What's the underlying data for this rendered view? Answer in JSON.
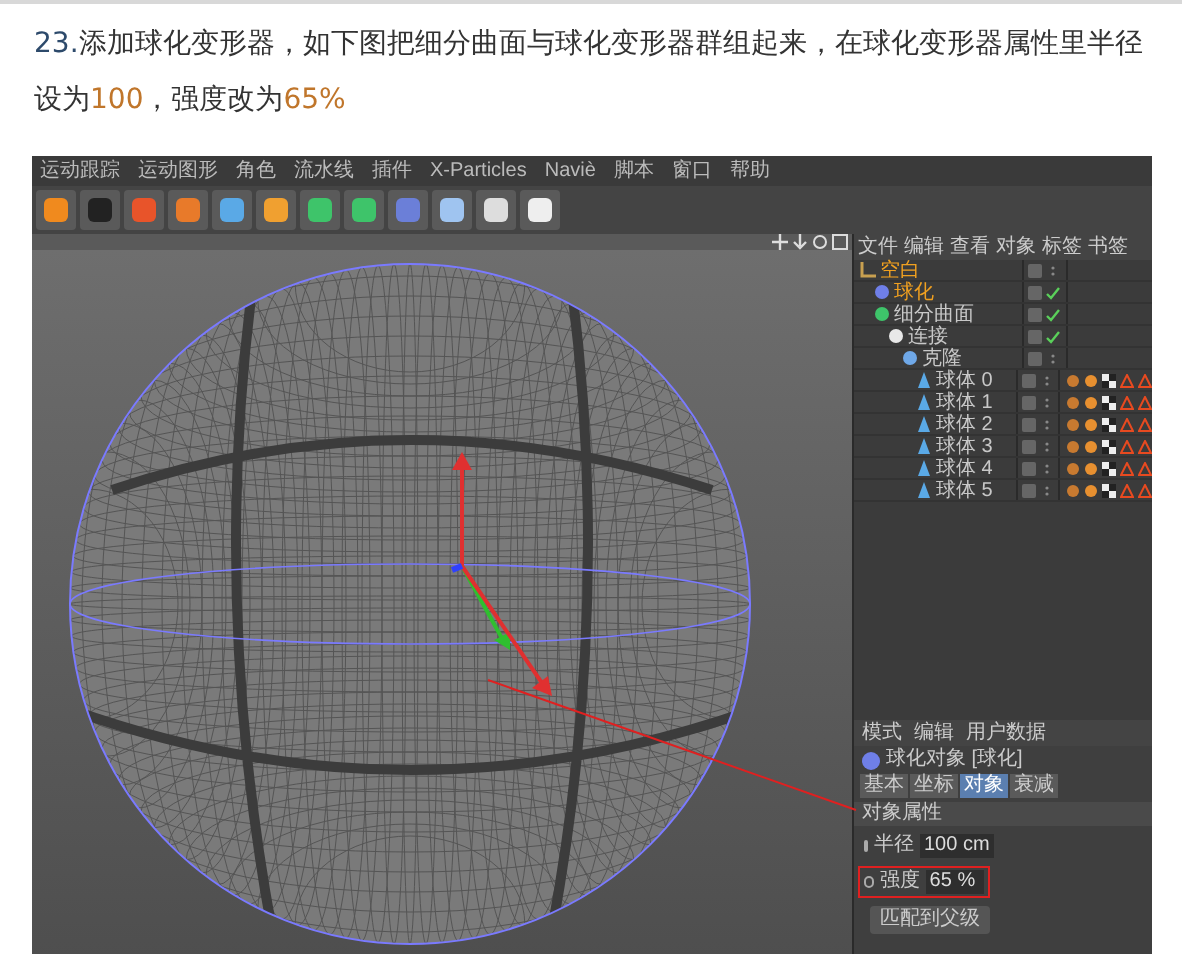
{
  "step_text": [
    {
      "kind": "index",
      "text": "23."
    },
    {
      "kind": "text",
      "text": "添加球化变形器，如下图把细分曲面与球化变形器群组起来，在球化变形器属性里半径设为"
    },
    {
      "kind": "number",
      "text": "100"
    },
    {
      "kind": "text",
      "text": "，强度改为"
    },
    {
      "kind": "number",
      "text": "65%"
    }
  ],
  "app": {
    "menu": [
      "运动跟踪",
      "运动图形",
      "角色",
      "流水线",
      "插件",
      "X-Particles",
      "Naviè",
      "脚本",
      "窗口",
      "帮助"
    ],
    "object_manager": {
      "menu": [
        "文件",
        "编辑",
        "查看",
        "对象",
        "标签",
        "书签"
      ],
      "tree": [
        {
          "name": "空白",
          "kind": "null",
          "selected": true,
          "enabled": false,
          "tags": false,
          "children": [
            {
              "name": "球化",
              "kind": "deformer",
              "selected": true,
              "enabled": true,
              "tags": false
            },
            {
              "name": "细分曲面",
              "kind": "subdivision",
              "selected": false,
              "enabled": true,
              "tags": false,
              "children": [
                {
                  "name": "连接",
                  "kind": "connect",
                  "selected": false,
                  "enabled": true,
                  "tags": false,
                  "children": [
                    {
                      "name": "克隆",
                      "kind": "cloner",
                      "selected": false,
                      "enabled": false,
                      "tags": false,
                      "children": [
                        {
                          "name": "球体 0",
                          "kind": "sphere",
                          "selected": false,
                          "enabled": false,
                          "tags": true
                        },
                        {
                          "name": "球体 1",
                          "kind": "sphere",
                          "selected": false,
                          "enabled": false,
                          "tags": true
                        },
                        {
                          "name": "球体 2",
                          "kind": "sphere",
                          "selected": false,
                          "enabled": false,
                          "tags": true
                        },
                        {
                          "name": "球体 3",
                          "kind": "sphere",
                          "selected": false,
                          "enabled": false,
                          "tags": true
                        },
                        {
                          "name": "球体 4",
                          "kind": "sphere",
                          "selected": false,
                          "enabled": false,
                          "tags": true
                        },
                        {
                          "name": "球体 5",
                          "kind": "sphere",
                          "selected": false,
                          "enabled": false,
                          "tags": true
                        }
                      ]
                    }
                  ]
                }
              ]
            }
          ]
        }
      ]
    },
    "attributes": {
      "menu": [
        "模式",
        "编辑",
        "用户数据"
      ],
      "object_title": "球化对象 [球化]",
      "tabs": [
        {
          "label": "基本",
          "selected": false
        },
        {
          "label": "坐标",
          "selected": false
        },
        {
          "label": "对象",
          "selected": true
        },
        {
          "label": "衰减",
          "selected": false
        }
      ],
      "section": "对象属性",
      "fields": [
        {
          "label": "半径",
          "value": "100 cm",
          "highlighted": false
        },
        {
          "label": "强度",
          "value": "65 %",
          "highlighted": true
        }
      ],
      "button": "匹配到父级"
    }
  }
}
